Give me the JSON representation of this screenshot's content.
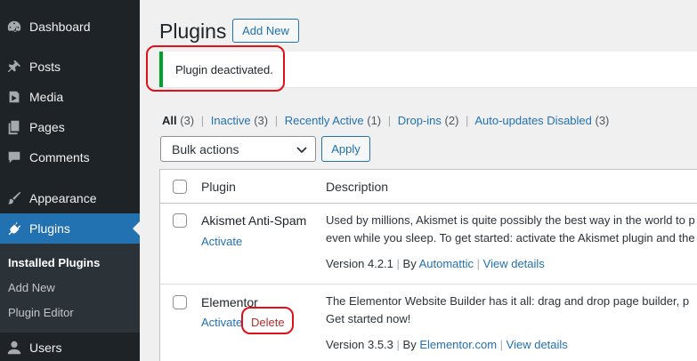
{
  "sidebar": {
    "items": [
      {
        "label": "Dashboard",
        "icon": "dashboard-icon"
      },
      {
        "label": "Posts",
        "icon": "pin-icon"
      },
      {
        "label": "Media",
        "icon": "media-icon"
      },
      {
        "label": "Pages",
        "icon": "pages-icon"
      },
      {
        "label": "Comments",
        "icon": "comment-icon"
      },
      {
        "label": "Appearance",
        "icon": "brush-icon"
      },
      {
        "label": "Plugins",
        "icon": "plugin-icon"
      },
      {
        "label": "Users",
        "icon": "user-icon"
      }
    ],
    "active": "Plugins",
    "submenu": [
      "Installed Plugins",
      "Add New",
      "Plugin Editor"
    ]
  },
  "header": {
    "title": "Plugins",
    "add_new": "Add New"
  },
  "notice": {
    "text": "Plugin deactivated."
  },
  "filters": {
    "all": {
      "label": "All",
      "count": "(3)"
    },
    "items": [
      {
        "label": "Inactive",
        "count": "(3)"
      },
      {
        "label": "Recently Active",
        "count": "(1)"
      },
      {
        "label": "Drop-ins",
        "count": "(2)"
      },
      {
        "label": "Auto-updates Disabled",
        "count": "(3)"
      }
    ],
    "separator": "|"
  },
  "bulk": {
    "selected": "Bulk actions",
    "apply": "Apply"
  },
  "table": {
    "headers": {
      "plugin": "Plugin",
      "description": "Description"
    },
    "rows": [
      {
        "name": "Akismet Anti-Spam",
        "actions": [
          "Activate"
        ],
        "desc_line1": "Used by millions, Akismet is quite possibly the best way in the world to p",
        "desc_line2": "even while you sleep. To get started: activate the Akismet plugin and the",
        "version": "Version 4.2.1",
        "by": "By",
        "author": "Automattic",
        "details": "View details"
      },
      {
        "name": "Elementor",
        "actions": [
          "Activate",
          "Delete"
        ],
        "desc_line1": "The Elementor Website Builder has it all: drag and drop page builder, p",
        "desc_line2": "Get started now!",
        "version": "Version 3.5.3",
        "by": "By",
        "author": "Elementor.com",
        "details": "View details"
      }
    ]
  },
  "colors": {
    "accent": "#2271b1",
    "sidebar": "#1d2327",
    "notice_success": "#00a32a",
    "highlight": "#e0101a",
    "delete": "#b32d2e"
  }
}
